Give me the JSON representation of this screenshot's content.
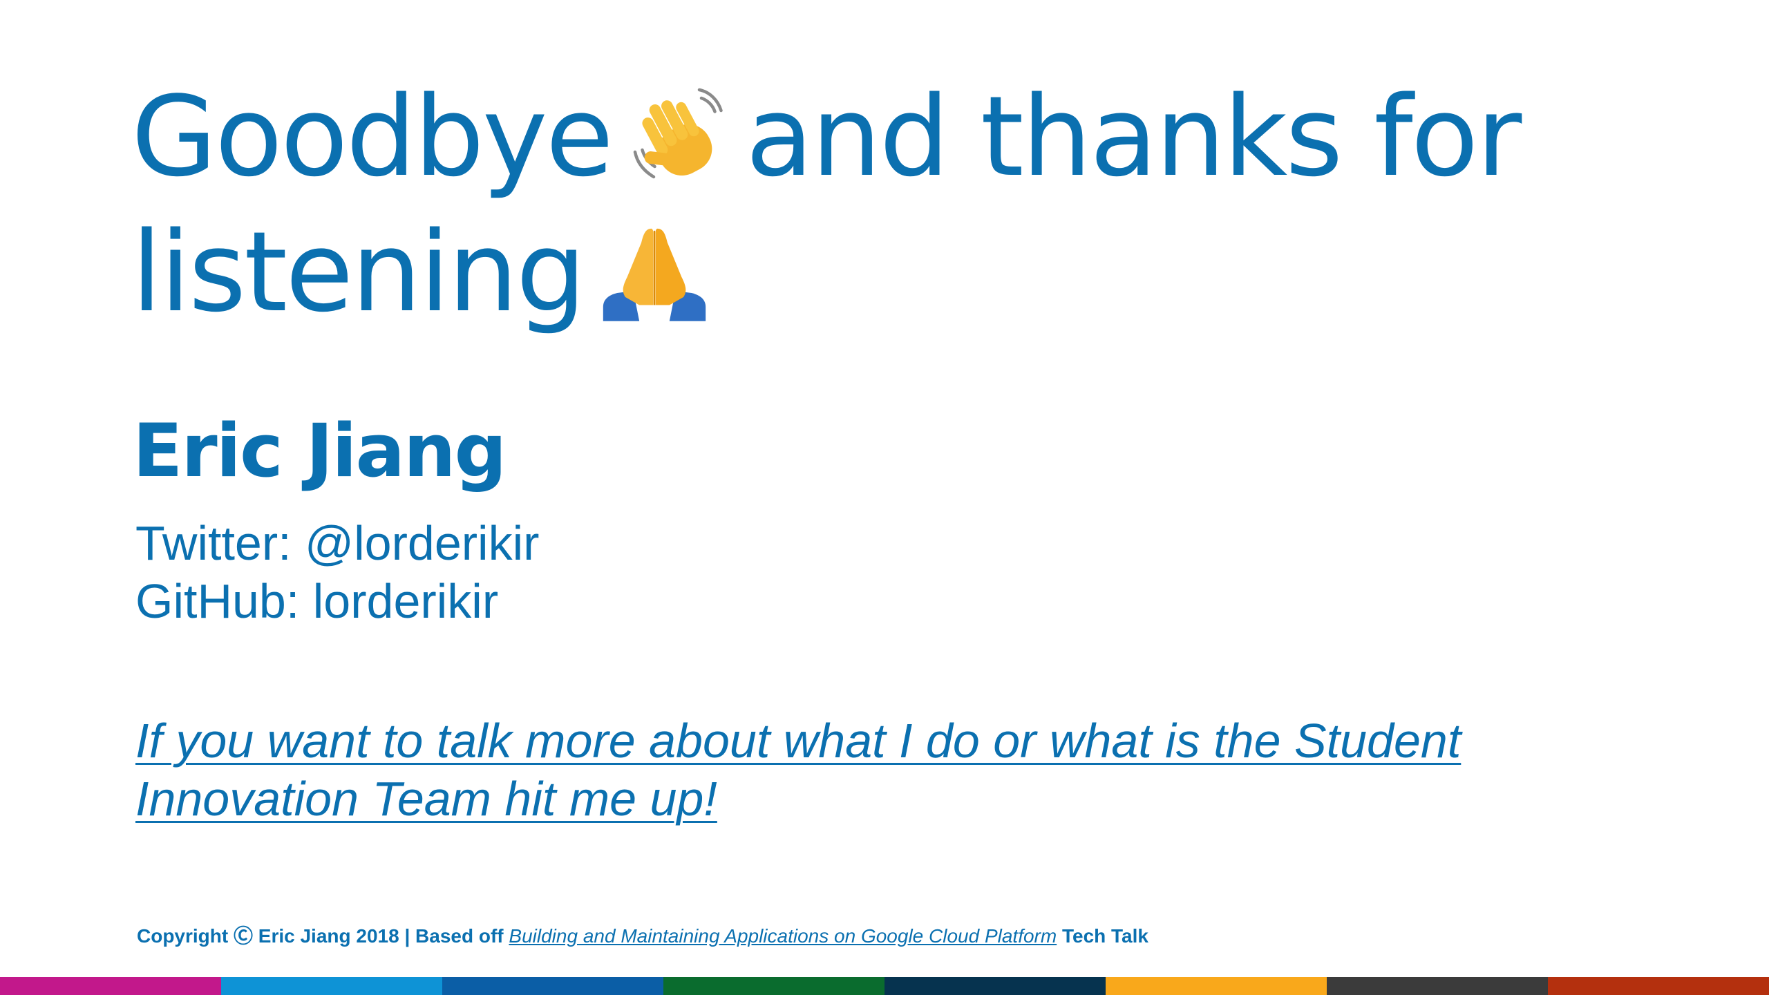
{
  "slide": {
    "title_line1_part1": "Goodbye",
    "title_line1_part2": "and thanks for",
    "title_line2": "listening",
    "title_emoji_1": "waving-hand-icon",
    "title_emoji_2": "folded-hands-icon",
    "name": "Eric Jiang",
    "twitter": "Twitter: @lorderikir",
    "github": "GitHub: lorderikir",
    "cta_line1": "If you want to talk more about what I do or what is the Student",
    "cta_line2": "Innovation Team hit me up!",
    "footer": {
      "prefix": "Copyright Ⓒ Eric Jiang 2018 | Based off ",
      "link": "Building and Maintaining Applications on Google Cloud Platform",
      "suffix": " Tech Talk"
    }
  },
  "colors": {
    "text": "#0b70b0",
    "bar": [
      "#c2188b",
      "#0e93d6",
      "#0b5ea6",
      "#0a6c2e",
      "#06334f",
      "#f9a81b",
      "#3b3b3b",
      "#b4300e"
    ]
  }
}
